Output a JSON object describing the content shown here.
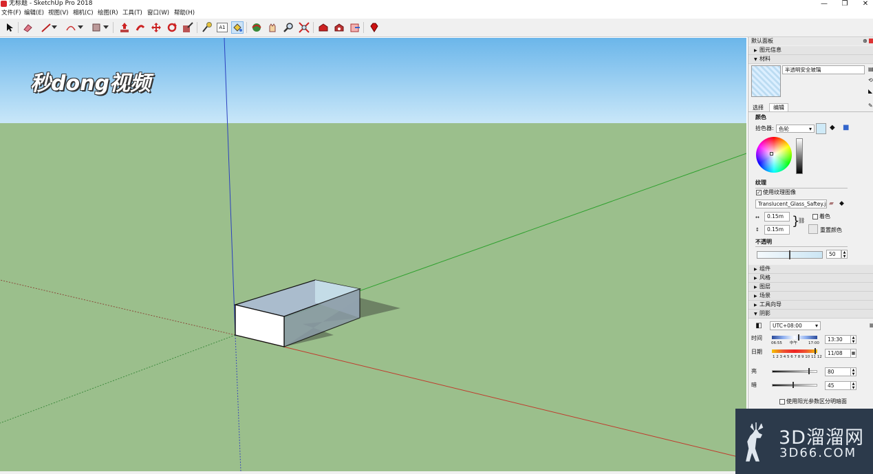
{
  "window": {
    "title": "无标题 - SketchUp Pro 2018",
    "minimize": "—",
    "maximize": "❐",
    "close": "✕"
  },
  "menu": [
    {
      "label": "文件(F)"
    },
    {
      "label": "编辑(E)"
    },
    {
      "label": "视图(V)"
    },
    {
      "label": "相机(C)"
    },
    {
      "label": "绘图(R)"
    },
    {
      "label": "工具(T)"
    },
    {
      "label": "窗口(W)"
    },
    {
      "label": "帮助(H)"
    }
  ],
  "toolbar": {
    "icons": [
      "select-icon",
      "eraser-icon",
      "line-icon",
      "arc-icon",
      "shape-icon",
      "push-pull-icon",
      "follow-me-icon",
      "move-icon",
      "rotate-icon",
      "scale-icon",
      "tape-measure-icon",
      "text-icon",
      "paint-bucket-icon",
      "orbit-icon",
      "pan-icon",
      "zoom-icon",
      "zoom-extents-icon",
      "warehouse-icon",
      "extension-warehouse-icon",
      "send-to-layout-icon",
      "ruby-icon"
    ],
    "text_tool_label": "A1"
  },
  "watermark_top": "秒dong视频",
  "tray": {
    "title": "默认面板",
    "sections": {
      "entity_info": "图元信息",
      "materials": "材料",
      "components": "组件",
      "styles": "风格",
      "layers": "图层",
      "scenes": "场景",
      "instructor": "工具向导",
      "shadows": "阴影"
    },
    "material_name": "半透明安全玻璃",
    "tabs": {
      "select": "选择",
      "edit": "编辑"
    },
    "color_heading": "颜色",
    "picker_label": "拾色器:",
    "picker_value": "色轮",
    "texture_heading": "纹理",
    "use_texture_label": "使用纹理图像",
    "use_texture_checked": "✓",
    "texture_file": "Translucent_Glass_Saftey.jpg",
    "texture_width": "0.15m",
    "texture_height": "0.15m",
    "colorize_label": "着色",
    "reset_color_label": "重置颜色",
    "opacity_heading": "不透明",
    "opacity_value": "50",
    "opacity_level": 0.5,
    "shadow": {
      "timezone": "UTC+08:00",
      "time_label": "时间",
      "time_start": "06:55",
      "time_noon": "中午",
      "time_end": "17:00",
      "time_value": "13:30",
      "date_label": "日期",
      "months": "1 2 3 4 5 6 7 8 9 10 11 12",
      "date_value": "11/08",
      "light_label": "亮",
      "light_value": "80",
      "dark_label": "暗",
      "dark_value": "45",
      "sun_shading_label": "使用阳光参数区分明暗面"
    }
  },
  "brand": {
    "name": "3D溜溜网",
    "domain": "3D66.COM"
  },
  "colors": {
    "sky": "#6bb6ea",
    "ground": "#9bbf8c",
    "axis_red": "#c0392b",
    "axis_green": "#2ea02e",
    "axis_blue": "#2a3fbf",
    "accent": "#d8262b"
  }
}
